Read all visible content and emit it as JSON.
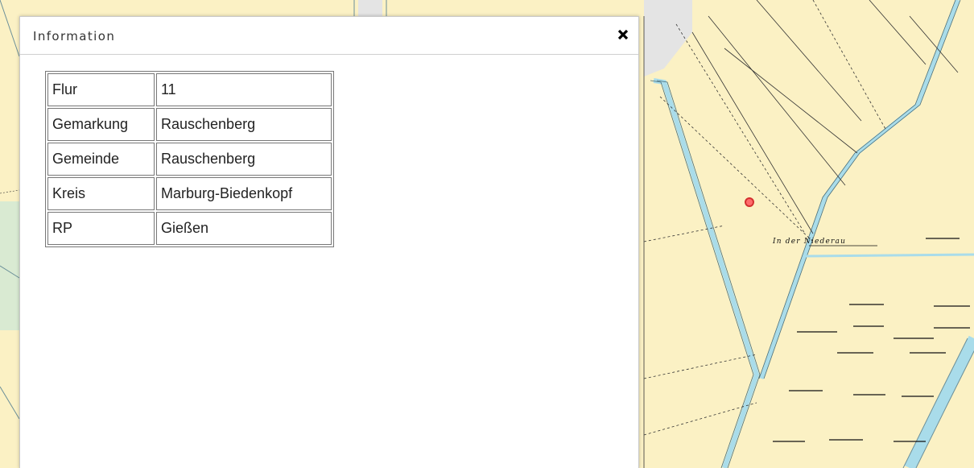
{
  "dialog": {
    "title": "Information",
    "close_icon": "close-x-icon"
  },
  "info_table": {
    "rows": [
      {
        "key": "Flur",
        "value": "11"
      },
      {
        "key": "Gemarkung",
        "value": "Rauschenberg"
      },
      {
        "key": "Gemeinde",
        "value": "Rauschenberg"
      },
      {
        "key": "Kreis",
        "value": "Marburg-Biedenkopf"
      },
      {
        "key": "RP",
        "value": "Gießen"
      }
    ]
  },
  "map": {
    "place_label": "In der Niederau",
    "marker_icon": "location-marker-icon",
    "colors": {
      "land": "#fbf1c4",
      "water": "#a9dcea",
      "road": "#e8e8e8",
      "marker": "#e53935"
    }
  }
}
